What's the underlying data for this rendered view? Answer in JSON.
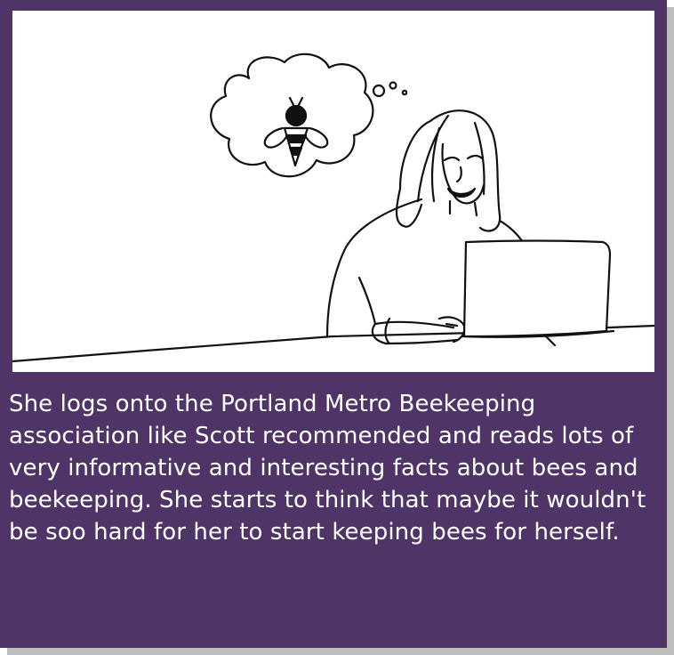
{
  "colors": {
    "background": "#4f3567",
    "panel": "#ffffff",
    "caption_text": "#ffffff",
    "shadow": "#bdbdbd"
  },
  "illustration": {
    "subject": "woman at laptop imagining a bee",
    "icons": [
      "thought-bubble-icon",
      "bee-icon",
      "laptop-icon"
    ]
  },
  "caption": {
    "text": "She logs onto the Portland Metro Beekeeping association like Scott recommended and reads lots of very informative and interesting facts about bees and beekeeping. She starts to think that maybe it wouldn't be soo hard for her to start keeping bees for herself."
  }
}
